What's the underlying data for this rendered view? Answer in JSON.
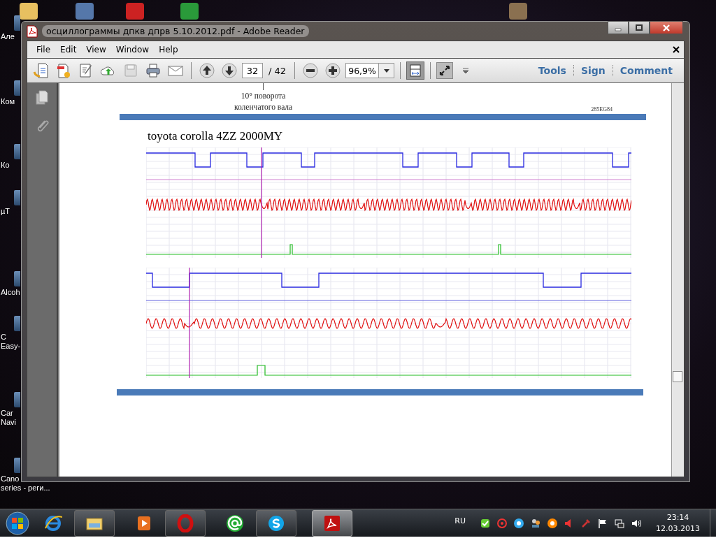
{
  "desktop": {
    "icons": [
      {
        "lines": [
          "Але"
        ]
      },
      {
        "lines": [
          "Ком"
        ]
      },
      {
        "lines": [
          "Ко"
        ]
      },
      {
        "lines": [
          "µT"
        ]
      },
      {
        "lines": [
          "Alcoh"
        ]
      },
      {
        "lines": [
          "C",
          "Easy-"
        ]
      },
      {
        "lines": [
          "Car",
          "Navi"
        ]
      },
      {
        "lines": [
          "Cano",
          "series - реги..."
        ]
      }
    ]
  },
  "window": {
    "title": "осциллограммы дпкв дпрв 5.10.2012.pdf - Adobe Reader",
    "menu": [
      "File",
      "Edit",
      "View",
      "Window",
      "Help"
    ],
    "toolbar": {
      "page_number": "32",
      "page_total": "/ 42",
      "zoom": "96,9%",
      "links": [
        "Tools",
        "Sign",
        "Comment"
      ]
    },
    "document": {
      "caption": [
        "10° поворота",
        "коленчатого вала"
      ],
      "code": "285EG84",
      "heading": "toyota corolla 4ZZ 2000MY"
    }
  },
  "taskbar": {
    "apps": [
      {
        "kind": "ie",
        "running": false,
        "selected": false
      },
      {
        "kind": "explorer",
        "running": true,
        "selected": false
      },
      {
        "kind": "media",
        "running": false,
        "selected": false
      },
      {
        "kind": "opera",
        "running": true,
        "selected": false
      },
      {
        "kind": "mail",
        "running": false,
        "selected": false
      },
      {
        "kind": "skype",
        "running": true,
        "selected": false
      },
      {
        "kind": "reader",
        "running": true,
        "selected": true
      }
    ],
    "language": "RU",
    "time": "23:14",
    "date": "12.03.2013"
  }
}
